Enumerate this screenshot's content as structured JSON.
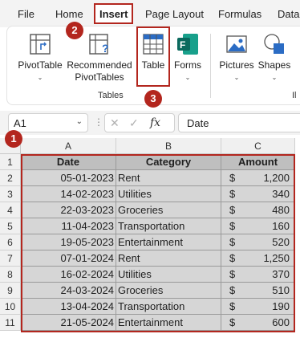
{
  "menu": {
    "tabs": [
      "File",
      "Home",
      "Insert",
      "Page Layout",
      "Formulas",
      "Data"
    ]
  },
  "ribbon": {
    "pivot_table": "PivotTable",
    "recommended_line1": "Recommended",
    "recommended_line2": "PivotTables",
    "table": "Table",
    "forms": "Forms",
    "pictures": "Pictures",
    "shapes": "Shapes",
    "group_tables": "Tables",
    "group_illustrations": "Il"
  },
  "formula_bar": {
    "name_box": "A1",
    "fx": "fx",
    "content": "Date"
  },
  "sheet": {
    "columns": [
      "A",
      "B",
      "C"
    ],
    "rows": [
      "1",
      "2",
      "3",
      "4",
      "5",
      "6",
      "7",
      "8",
      "9",
      "10",
      "11"
    ],
    "headers": [
      "Date",
      "Category",
      "Amount"
    ],
    "currency": "$",
    "data": [
      [
        "05-01-2023",
        "Rent",
        "1,200"
      ],
      [
        "14-02-2023",
        "Utilities",
        "340"
      ],
      [
        "22-03-2023",
        "Groceries",
        "480"
      ],
      [
        "11-04-2023",
        "Transportation",
        "160"
      ],
      [
        "19-05-2023",
        "Entertainment",
        "520"
      ],
      [
        "07-01-2024",
        "Rent",
        "1,250"
      ],
      [
        "16-02-2024",
        "Utilities",
        "370"
      ],
      [
        "24-03-2024",
        "Groceries",
        "510"
      ],
      [
        "13-04-2024",
        "Transportation",
        "190"
      ],
      [
        "21-05-2024",
        "Entertainment",
        "600"
      ]
    ]
  },
  "callouts": {
    "one": "1",
    "two": "2",
    "three": "3"
  },
  "colors": {
    "callout": "#b3261e",
    "table_header": "#bfbfbf",
    "table_body": "#d6d6d6"
  }
}
